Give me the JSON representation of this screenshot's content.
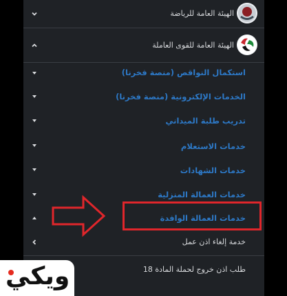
{
  "menu": {
    "top_items": [
      {
        "label": "الهيئة العامة للرياضة",
        "state": "collapsed"
      },
      {
        "label": "الهيئة العامة للقوى العاملة",
        "state": "expanded"
      }
    ],
    "sub_items": [
      {
        "label": "استكمال النواقص (منصة فخرنا)"
      },
      {
        "label": "الخدمات الإلكترونية (منصة فخرنا)"
      },
      {
        "label": "تدريب طلبة الميداني"
      },
      {
        "label": "خدمات الاستعلام"
      },
      {
        "label": "خدمات الشهادات"
      },
      {
        "label": "خدمات العمالة المنزلية"
      },
      {
        "label": "خدمات العمالة الوافدة"
      }
    ],
    "leaf_items": [
      {
        "label": "خدمة إلغاء اذن عمل"
      },
      {
        "label": "طلب اذن خروج لحملة المادة 18"
      }
    ]
  },
  "watermark": {
    "text": "ويكي"
  },
  "colors": {
    "accent_blue": "#2d79c7",
    "highlight_red": "#e0262b",
    "panel_bg": "#1f2226"
  }
}
